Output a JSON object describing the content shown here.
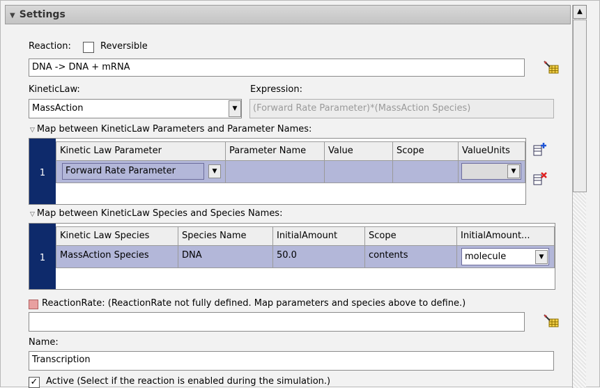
{
  "panel": {
    "title": "Settings"
  },
  "reaction": {
    "label": "Reaction:",
    "reversible_label": "Reversible",
    "reversible_checked": false,
    "value": "DNA -> DNA + mRNA"
  },
  "kinetic_law": {
    "label": "KineticLaw:",
    "value": "MassAction"
  },
  "expression": {
    "label": "Expression:",
    "value": "(Forward Rate Parameter)*(MassAction Species)"
  },
  "param_map": {
    "title": "Map between KineticLaw Parameters and Parameter Names:",
    "columns": [
      "Kinetic Law Parameter",
      "Parameter Name",
      "Value",
      "Scope",
      "ValueUnits"
    ],
    "rows": [
      {
        "num": "1",
        "kinetic_law_parameter": "Forward Rate Parameter",
        "parameter_name": "",
        "value": "",
        "scope": "",
        "value_units": ""
      }
    ]
  },
  "species_map": {
    "title": "Map between KineticLaw Species and Species Names:",
    "columns": [
      "Kinetic Law Species",
      "Species Name",
      "InitialAmount",
      "Scope",
      "InitialAmount..."
    ],
    "rows": [
      {
        "num": "1",
        "kinetic_law_species": "MassAction Species",
        "species_name": "DNA",
        "initial_amount": "50.0",
        "scope": "contents",
        "initial_amount_units": "molecule"
      }
    ]
  },
  "reaction_rate": {
    "label": "ReactionRate: (ReactionRate not fully defined. Map parameters and species above to define.)",
    "value": ""
  },
  "name": {
    "label": "Name:",
    "value": "Transcription"
  },
  "active": {
    "label": "Active (Select if the reaction is enabled during the simulation.)",
    "checked": true
  },
  "colors": {
    "row_header": "#0e2a6b",
    "selected_cell": "#b3b7d9",
    "warning": "#e8a0a0"
  }
}
